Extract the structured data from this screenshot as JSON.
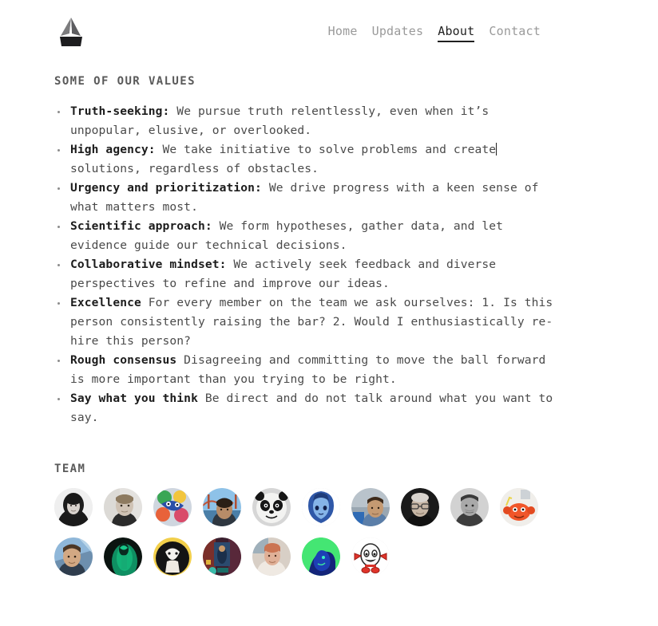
{
  "header": {
    "logo_name": "company-logo",
    "nav": [
      {
        "label": "Home",
        "active": false
      },
      {
        "label": "Updates",
        "active": false
      },
      {
        "label": "About",
        "active": true
      },
      {
        "label": "Contact",
        "active": false
      }
    ]
  },
  "values": {
    "heading": "SOME OF OUR VALUES",
    "items": [
      {
        "term": "Truth-seeking:",
        "text": " We pursue truth relentlessly, even when it’s unpopular, elusive, or overlooked.",
        "caret": false
      },
      {
        "term": "High agency:",
        "text": " We take initiative to solve problems and create",
        "text_after_caret": " solutions, regardless of obstacles.",
        "caret": true
      },
      {
        "term": "Urgency and prioritization:",
        "text": " We drive progress with a keen sense of what matters most.",
        "caret": false
      },
      {
        "term": "Scientific approach:",
        "text": " We form hypotheses, gather data, and let evidence guide our technical decisions.",
        "caret": false
      },
      {
        "term": "Collaborative mindset:",
        "text": " We actively seek feedback and diverse perspectives to refine and improve our ideas.",
        "caret": false
      },
      {
        "term": "Excellence",
        "text": " For every member on the team we ask ourselves: 1. Is this person consistently raising the bar? 2. Would I enthusiastically re-hire this person?",
        "caret": false
      },
      {
        "term": "Rough consensus",
        "text": " Disagreeing and committing to move the ball forward is more important than you trying to be right.",
        "caret": false
      },
      {
        "term": "Say what you think",
        "text": " Be direct and do not talk around what you want to say.",
        "caret": false
      }
    ]
  },
  "team": {
    "heading": "TEAM",
    "members": [
      {
        "name": "avatar-portrait-woman-bw",
        "kind": "photo-bw-woman"
      },
      {
        "name": "avatar-portrait-man-bw",
        "kind": "photo-bw-man"
      },
      {
        "name": "avatar-colorful-abstract",
        "kind": "abstract-color"
      },
      {
        "name": "avatar-golden-gate-bridge",
        "kind": "photo-bridge"
      },
      {
        "name": "avatar-panda-character",
        "kind": "panda"
      },
      {
        "name": "avatar-blue-anime-character",
        "kind": "blue-anime"
      },
      {
        "name": "avatar-man-blue-outdoors",
        "kind": "photo-blue-outdoor"
      },
      {
        "name": "avatar-man-glasses-dark",
        "kind": "photo-dark-glasses"
      },
      {
        "name": "avatar-man-grayscale",
        "kind": "photo-gray-man"
      },
      {
        "name": "avatar-orange-crab-creature",
        "kind": "orange-crab"
      },
      {
        "name": "avatar-man-outdoor-portrait",
        "kind": "photo-outdoor-man"
      },
      {
        "name": "avatar-green-dark-figure",
        "kind": "green-dark"
      },
      {
        "name": "avatar-yellow-cartoon-figure",
        "kind": "yellow-cartoon"
      },
      {
        "name": "avatar-game-scene-character",
        "kind": "game-scene"
      },
      {
        "name": "avatar-person-light-portrait",
        "kind": "photo-light-person"
      },
      {
        "name": "avatar-green-neon-profile",
        "kind": "green-neon"
      },
      {
        "name": "avatar-white-egg-mascot",
        "kind": "egg-mascot"
      }
    ]
  },
  "colors": {
    "text": "#4a4a4a",
    "heading": "#5a5a5a",
    "term": "#1c1c1c",
    "nav_inactive": "#9a9a9a",
    "nav_active": "#1f1f1f",
    "background": "#ffffff"
  }
}
